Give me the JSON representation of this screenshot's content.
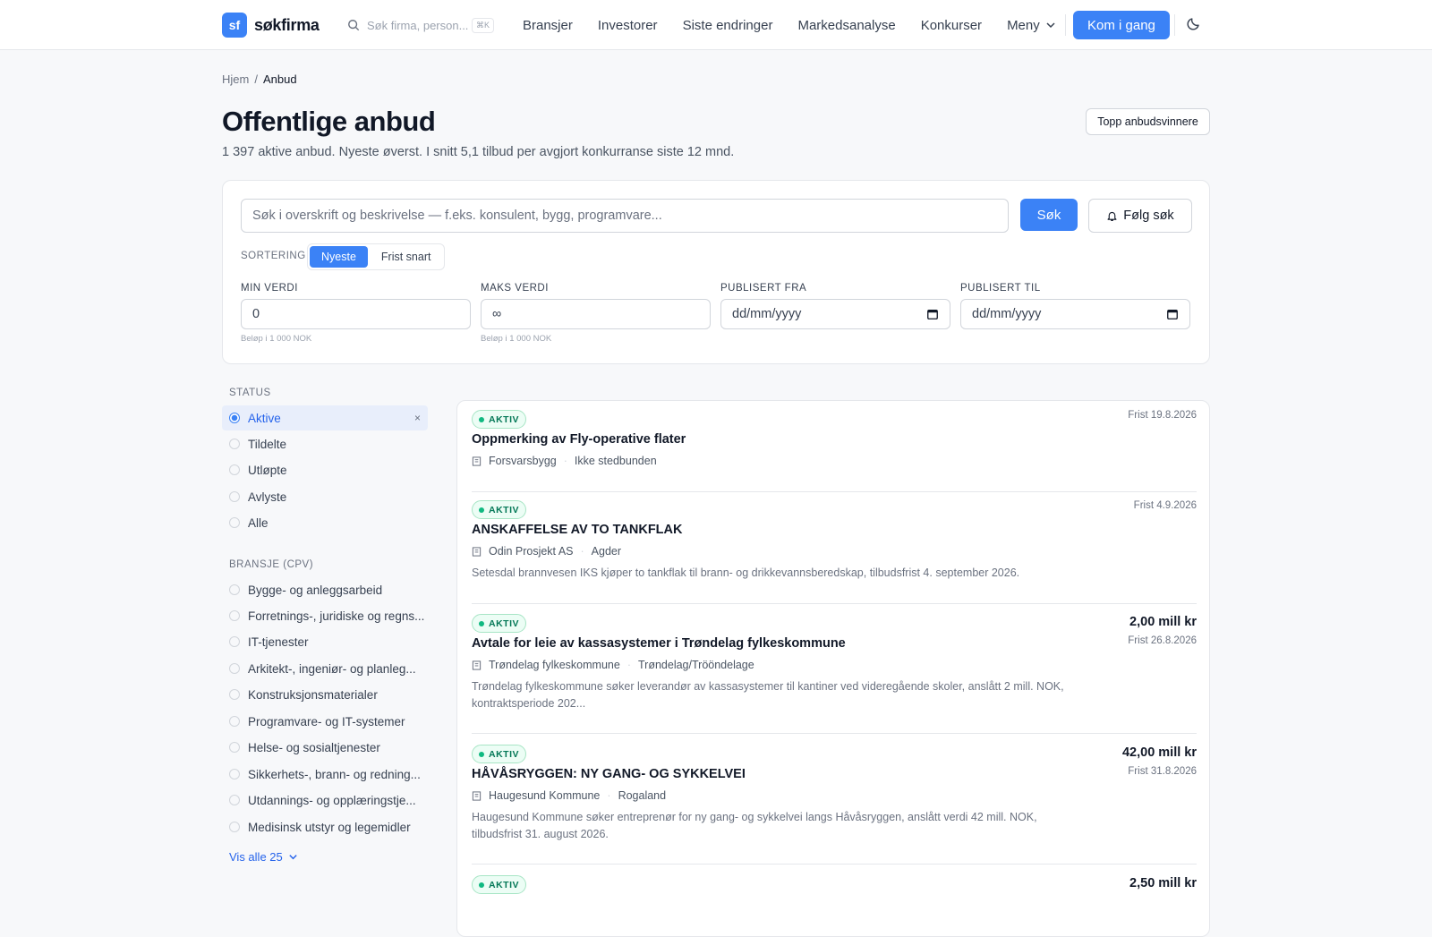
{
  "nav": {
    "logo_mark": "sf",
    "logo_text": "søkfirma",
    "search_placeholder": "Søk firma, person...",
    "search_shortcut": "⌘K",
    "links": [
      "Bransjer",
      "Investorer",
      "Siste endringer",
      "Markedsanalyse",
      "Konkurser"
    ],
    "menu_label": "Meny",
    "cta_label": "Kom i gang"
  },
  "breadcrumb": {
    "home": "Hjem",
    "separator": "/",
    "current": "Anbud"
  },
  "header": {
    "title": "Offentlige anbud",
    "subtitle": "1 397 aktive anbud. Nyeste øverst. I snitt 5,1 tilbud per avgjort konkurranse siste 12 mnd.",
    "top_winners_label": "Topp anbudsvinnere"
  },
  "filters": {
    "search_placeholder": "Søk i overskrift og beskrivelse — f.eks. konsulent, bygg, programvare...",
    "search_button": "Søk",
    "follow_button": "Følg søk",
    "sort_label": "SORTERING",
    "sort_options": [
      "Nyeste",
      "Frist snart"
    ],
    "sort_selected": "Nyeste",
    "min_label": "MIN VERDI",
    "min_value": "0",
    "min_hint": "Beløp i 1 000 NOK",
    "max_label": "MAKS VERDI",
    "max_value": "∞",
    "max_hint": "Beløp i 1 000 NOK",
    "from_label": "PUBLISERT FRA",
    "from_value": "dd/mm/yyyy",
    "to_label": "PUBLISERT TIL",
    "to_value": "dd/mm/yyyy"
  },
  "sidebar": {
    "status_heading": "STATUS",
    "status_items": [
      "Aktive",
      "Tildelte",
      "Utløpte",
      "Avlyste",
      "Alle"
    ],
    "status_selected": "Aktive",
    "clear_label": "×",
    "industry_heading": "BRANSJE (CPV)",
    "industry_items": [
      "Bygge- og anleggsarbeid",
      "Forretnings-, juridiske og regns...",
      "IT-tjenester",
      "Arkitekt-, ingeniør- og planleg...",
      "Konstruksjonsmaterialer",
      "Programvare- og IT-systemer",
      "Helse- og sosialtjenester",
      "Sikkerhets-, brann- og redning...",
      "Utdannings- og opplæringstje...",
      "Medisinsk utstyr og legemidler"
    ],
    "show_all": "Vis alle 25"
  },
  "tenders": [
    {
      "status": "AKTIV",
      "title": "Oppmerking av Fly-operative flater",
      "buyer": "Forsvarsbygg",
      "location": "Ikke stedbunden",
      "description": "",
      "value": "",
      "deadline": "Frist 19.8.2026"
    },
    {
      "status": "AKTIV",
      "title": "ANSKAFFELSE AV TO TANKFLAK",
      "buyer": "Odin Prosjekt AS",
      "location": "Agder",
      "description": "Setesdal brannvesen IKS kjøper to tankflak til brann- og drikkevannsberedskap, tilbudsfrist 4. september 2026.",
      "value": "",
      "deadline": "Frist 4.9.2026"
    },
    {
      "status": "AKTIV",
      "title": "Avtale for leie av kassasystemer i Trøndelag fylkeskommune",
      "buyer": "Trøndelag fylkeskommune",
      "location": "Trøndelag/Trööndelage",
      "description": "Trøndelag fylkeskommune søker leverandør av kassasystemer til kantiner ved videregående skoler, anslått 2 mill. NOK, kontraktsperiode 202...",
      "value": "2,00 mill kr",
      "deadline": "Frist 26.8.2026"
    },
    {
      "status": "AKTIV",
      "title": "HÅVÅSRYGGEN: NY GANG- OG SYKKELVEI",
      "buyer": "Haugesund Kommune",
      "location": "Rogaland",
      "description": "Haugesund Kommune søker entreprenør for ny gang- og sykkelvei langs Håvåsryggen, anslått verdi 42 mill. NOK, tilbudsfrist 31. august 2026.",
      "value": "42,00 mill kr",
      "deadline": "Frist 31.8.2026"
    },
    {
      "status": "AKTIV",
      "title": "",
      "buyer": "",
      "location": "",
      "description": "",
      "value": "2,50 mill kr",
      "deadline": ""
    }
  ]
}
